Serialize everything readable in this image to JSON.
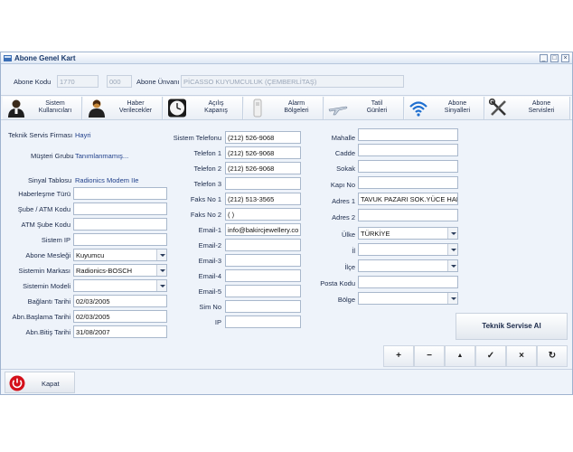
{
  "window": {
    "title": "Abone Genel Kart",
    "minimize_glyph": "_",
    "maximize_glyph": "□",
    "close_glyph": "×"
  },
  "header": {
    "abone_kodu_label": "Abone Kodu",
    "abone_kodu_value": "1770",
    "abone_kodu_suffix": "000",
    "abone_unvani_label": "Abone Ünvanı",
    "abone_unvani_value": "PİCASSO KUYUMCULUK (ÇEMBERLİTAŞ)"
  },
  "tabs": [
    {
      "label1": "Sistem",
      "label2": "Kullanıcıları",
      "icon": "users-icon"
    },
    {
      "label1": "Haber",
      "label2": "Verilecekler",
      "icon": "contact-person-icon"
    },
    {
      "label1": "Açılış",
      "label2": "Kapanış",
      "icon": "clock-icon"
    },
    {
      "label1": "Alarm",
      "label2": "Bölgeleri",
      "icon": "sensor-icon"
    },
    {
      "label1": "Tatil",
      "label2": "Günleri",
      "icon": "airplane-icon"
    },
    {
      "label1": "Abone",
      "label2": "Sinyalleri",
      "icon": "wifi-signal-icon"
    },
    {
      "label1": "Abone",
      "label2": "Servisleri",
      "icon": "tools-icon"
    }
  ],
  "left": {
    "teknik_servis_label": "Teknik Servis Firması",
    "teknik_servis_value": "Hayri",
    "musteri_grubu_label": "Müşteri Grubu",
    "musteri_grubu_value": "Tanımlanmamış...",
    "sinyal_tablosu_label": "Sinyal Tablosu",
    "sinyal_tablosu_value": "Radionics Modem IIe",
    "haberlesme_turu_label": "Haberleşme Türü",
    "haberlesme_turu_value": "",
    "sube_atm_kodu_label": "Şube / ATM Kodu",
    "sube_atm_kodu_value": "",
    "atm_sube_kodu_label": "ATM Şube Kodu",
    "atm_sube_kodu_value": "",
    "sistem_ip_label": "Sistem IP",
    "sistem_ip_value": "",
    "abone_meslegi_label": "Abone Mesleği",
    "abone_meslegi_value": "Kuyumcu",
    "sistemin_markasi_label": "Sistemin Markası",
    "sistemin_markasi_value": "Radionics-BOSCH",
    "sistemin_modeli_label": "Sistemin Modeli",
    "sistemin_modeli_value": "",
    "baglanti_tarihi_label": "Bağlantı Tarihi",
    "baglanti_tarihi_value": "02/03/2005",
    "abn_baslama_label": "Abn.Başlama Tarihi",
    "abn_baslama_value": "02/03/2005",
    "abn_bitis_label": "Abn.Bitiş Tarihi",
    "abn_bitis_value": "31/08/2007"
  },
  "middle": {
    "sistem_telefonu_label": "Sistem Telefonu",
    "sistem_telefonu_value": "(212) 526-9068",
    "telefon1_label": "Telefon 1",
    "telefon1_value": "(212) 526-9068",
    "telefon2_label": "Telefon 2",
    "telefon2_value": "(212) 526-9068",
    "telefon3_label": "Telefon 3",
    "telefon3_value": "",
    "faks1_label": "Faks No 1",
    "faks1_value": "(212) 513-3565",
    "faks2_label": "Faks No 2",
    "faks2_value": "(   )",
    "email1_label": "Email-1",
    "email1_value": "info@bakircjewellery.co",
    "email2_label": "Email-2",
    "email2_value": "",
    "email3_label": "Email-3",
    "email3_value": "",
    "email4_label": "Email-4",
    "email4_value": "",
    "email5_label": "Email-5",
    "email5_value": "",
    "sim_no_label": "Sim No",
    "sim_no_value": "",
    "ip_label": "IP",
    "ip_value": ""
  },
  "right": {
    "mahalle_label": "Mahalle",
    "mahalle_value": "",
    "cadde_label": "Cadde",
    "cadde_value": "",
    "sokak_label": "Sokak",
    "sokak_value": "",
    "kapi_no_label": "Kapı No",
    "kapi_no_value": "",
    "adres1_label": "Adres 1",
    "adres1_value": "TAVUK PAZARI SOK.YÜCE HAN",
    "adres2_label": "Adres 2",
    "adres2_value": "",
    "ulke_label": "Ülke",
    "ulke_value": "TÜRKİYE",
    "il_label": "İl",
    "il_value": "",
    "ilce_label": "İlçe",
    "ilce_value": "",
    "posta_kodu_label": "Posta Kodu",
    "posta_kodu_value": "",
    "bolge_label": "Bölge",
    "bolge_value": ""
  },
  "actions": {
    "teknik_servise_al": "Teknik Servise Al",
    "add_glyph": "+",
    "remove_glyph": "−",
    "up_glyph": "▲",
    "confirm_glyph": "✓",
    "cancel_glyph": "×",
    "refresh_glyph": "↻"
  },
  "footer": {
    "kapat_label": "Kapat"
  },
  "colors": {
    "window_bg": "#eef3fa",
    "value_text": "#1f3f8a",
    "close_red": "#d4101a"
  }
}
